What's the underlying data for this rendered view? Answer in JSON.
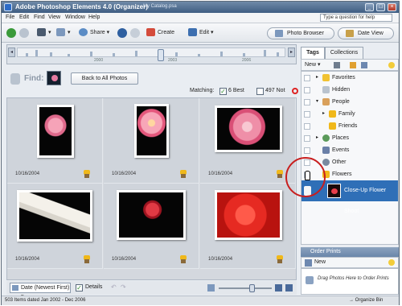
{
  "window": {
    "title": "Adobe Photoshop Elements 4.0 (Organizer)",
    "catalog": "My Catalog.psa",
    "controls": {
      "minimize": "_",
      "maximize": "□",
      "close": "×"
    }
  },
  "menu": [
    "File",
    "Edit",
    "Find",
    "View",
    "Window",
    "Help"
  ],
  "help_search": "Type a question for help",
  "toolbar": {
    "share": "Share",
    "create": "Create",
    "edit": "Edit",
    "photo_browser": "Photo Browser",
    "date_view": "Date View"
  },
  "timeline": {
    "years": [
      "2000",
      "2003",
      "2006"
    ]
  },
  "find": {
    "label": "Find:",
    "back_button": "Back to All Photos",
    "matching_label": "Matching:",
    "best_count": "6 Best",
    "not_count": "497 Not"
  },
  "photos": [
    {
      "date": "10/16/2004",
      "kind": "pink-gerbera"
    },
    {
      "date": "10/16/2004",
      "kind": "pink-gerbera-closeup"
    },
    {
      "date": "10/16/2004",
      "kind": "pink-gerbera-wide"
    },
    {
      "date": "10/16/2004",
      "kind": "white-lily"
    },
    {
      "date": "10/16/2004",
      "kind": "red-rosebud"
    },
    {
      "date": "10/16/2004",
      "kind": "red-rose-macro"
    }
  ],
  "bottom": {
    "sort": "Date (Newest First)",
    "details": "Details"
  },
  "status": {
    "items": "503 Items dated Jan 2002 - Dec 2006",
    "organize_bin": "Organize Bin"
  },
  "tags_panel": {
    "tabs": [
      "Tags",
      "Collections"
    ],
    "new_label": "New",
    "items": [
      {
        "label": "Favorites",
        "icon_color": "#f1c232"
      },
      {
        "label": "Hidden",
        "icon_color": "#b9c3cf"
      },
      {
        "label": "People",
        "icon_color": "#d9a05b"
      },
      {
        "label": "Family",
        "icon_color": "#f0b81a"
      },
      {
        "label": "Friends",
        "icon_color": "#f0b81a"
      },
      {
        "label": "Places",
        "icon_color": "#5a9a5a"
      },
      {
        "label": "Events",
        "icon_color": "#6a80a8"
      },
      {
        "label": "Other",
        "icon_color": "#7a8aa0"
      },
      {
        "label": "Flowers",
        "icon_color": "#f0b81a"
      }
    ],
    "selected_tag": "Close-Up Flower Shoot"
  },
  "order_prints": {
    "header": "Order Prints",
    "new_label": "New",
    "hint": "Drag Photos Here to Order Prints"
  },
  "colors": {
    "selection": "#2f6fb7",
    "annotation_circle": "#c81e1e",
    "title_bar": "#3f5d82"
  }
}
